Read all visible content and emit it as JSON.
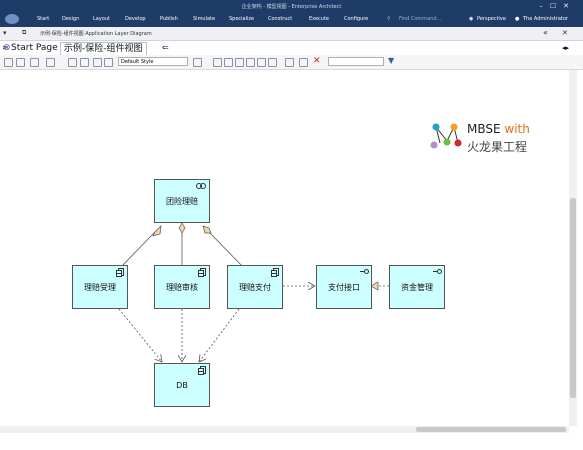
{
  "window": {
    "title": "企业架构 - 模型视图 - Enterprise Architect"
  },
  "menu": {
    "items": [
      "Start",
      "Design",
      "Layout",
      "Develop",
      "Publish",
      "Simulate",
      "Specialize",
      "Construct",
      "Execute",
      "Configure"
    ],
    "find_command": "Find Command...",
    "perspective": "Perspective",
    "user": "The Administrator"
  },
  "breadcrumb": "示例-保险-组件视图  Application Layer Diagram",
  "tabs": {
    "start": "Start Page",
    "diagram": "示例-保险-组件视图"
  },
  "toolbar": {
    "style_select": "Default Style"
  },
  "diagram": {
    "nodes": {
      "group_claim": "团险理赔",
      "claim_accept": "理赔受理",
      "claim_review": "理赔审核",
      "claim_pay": "理赔支付",
      "pay_interface": "支付接口",
      "fund_mgmt": "资金管理",
      "db": "DB"
    },
    "icons": {
      "group_claim": "collaboration-icon",
      "component": "component-icon",
      "interface": "interface-icon"
    }
  },
  "logo": {
    "line1_a": "MBSE",
    "line1_b": "with",
    "line2": "火龙果工程"
  }
}
